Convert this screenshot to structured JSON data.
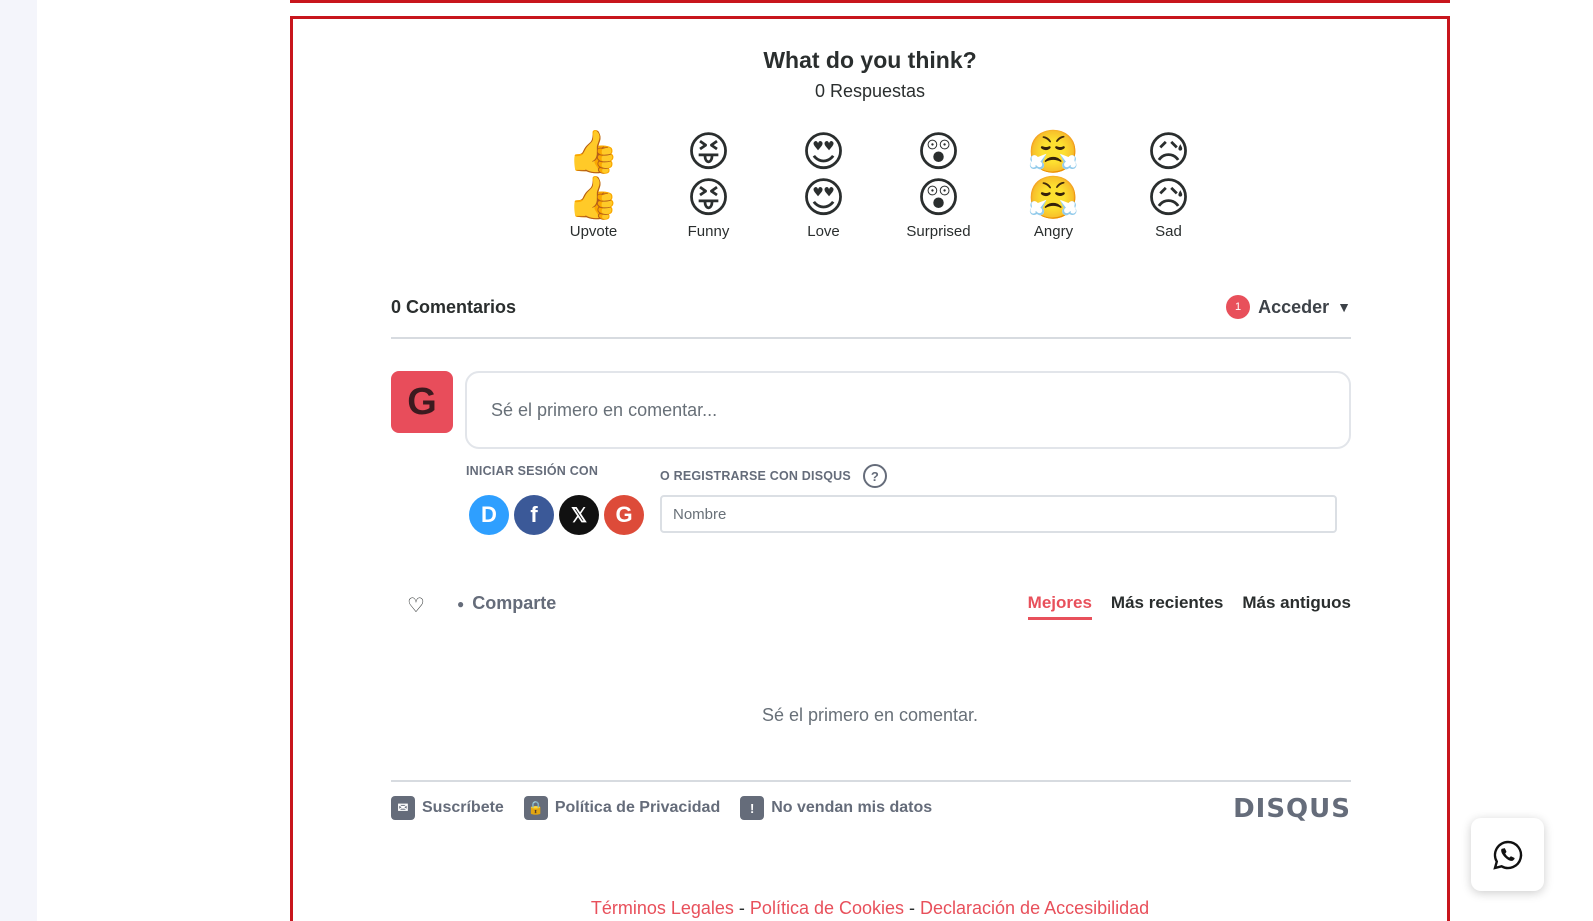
{
  "reactions": {
    "title": "What do you think?",
    "count": "0 Respuestas",
    "items": [
      {
        "label": "Upvote",
        "emoji": "👍"
      },
      {
        "label": "Funny",
        "emoji": "😝"
      },
      {
        "label": "Love",
        "emoji": "😍"
      },
      {
        "label": "Surprised",
        "emoji": "😲"
      },
      {
        "label": "Angry",
        "emoji": "😤"
      },
      {
        "label": "Sad",
        "emoji": "😥"
      }
    ]
  },
  "thread": {
    "count_label": "0 Comentarios",
    "login_label": "Acceder",
    "notification_count": "1",
    "caret": "▼"
  },
  "composer": {
    "avatar_letter": "G",
    "placeholder": "Sé el primero en comentar...",
    "signin_label": "INICIAR SESIÓN CON",
    "register_label": "O REGISTRARSE CON DISQUS",
    "help": "?",
    "name_placeholder": "Nombre",
    "socials": {
      "disqus": "D",
      "facebook": "f",
      "x": "𝕏",
      "google": "G"
    }
  },
  "toolbar": {
    "share_label": "Comparte",
    "sort": {
      "best": "Mejores",
      "newest": "Más recientes",
      "oldest": "Más antiguos"
    }
  },
  "empty_message": "Sé el primero en comentar.",
  "footer": {
    "subscribe": "Suscríbete",
    "privacy": "Política de Privacidad",
    "do_not_sell": "No vendan mis datos",
    "brand": "DISQUS"
  },
  "legal": {
    "terms": "Términos Legales",
    "cookies": "Política de Cookies",
    "accessibility": "Declaración de Accesibilidad",
    "separator": " - "
  },
  "colors": {
    "accent": "#e8505b",
    "frame": "#c8161d",
    "muted": "#656c7a"
  }
}
